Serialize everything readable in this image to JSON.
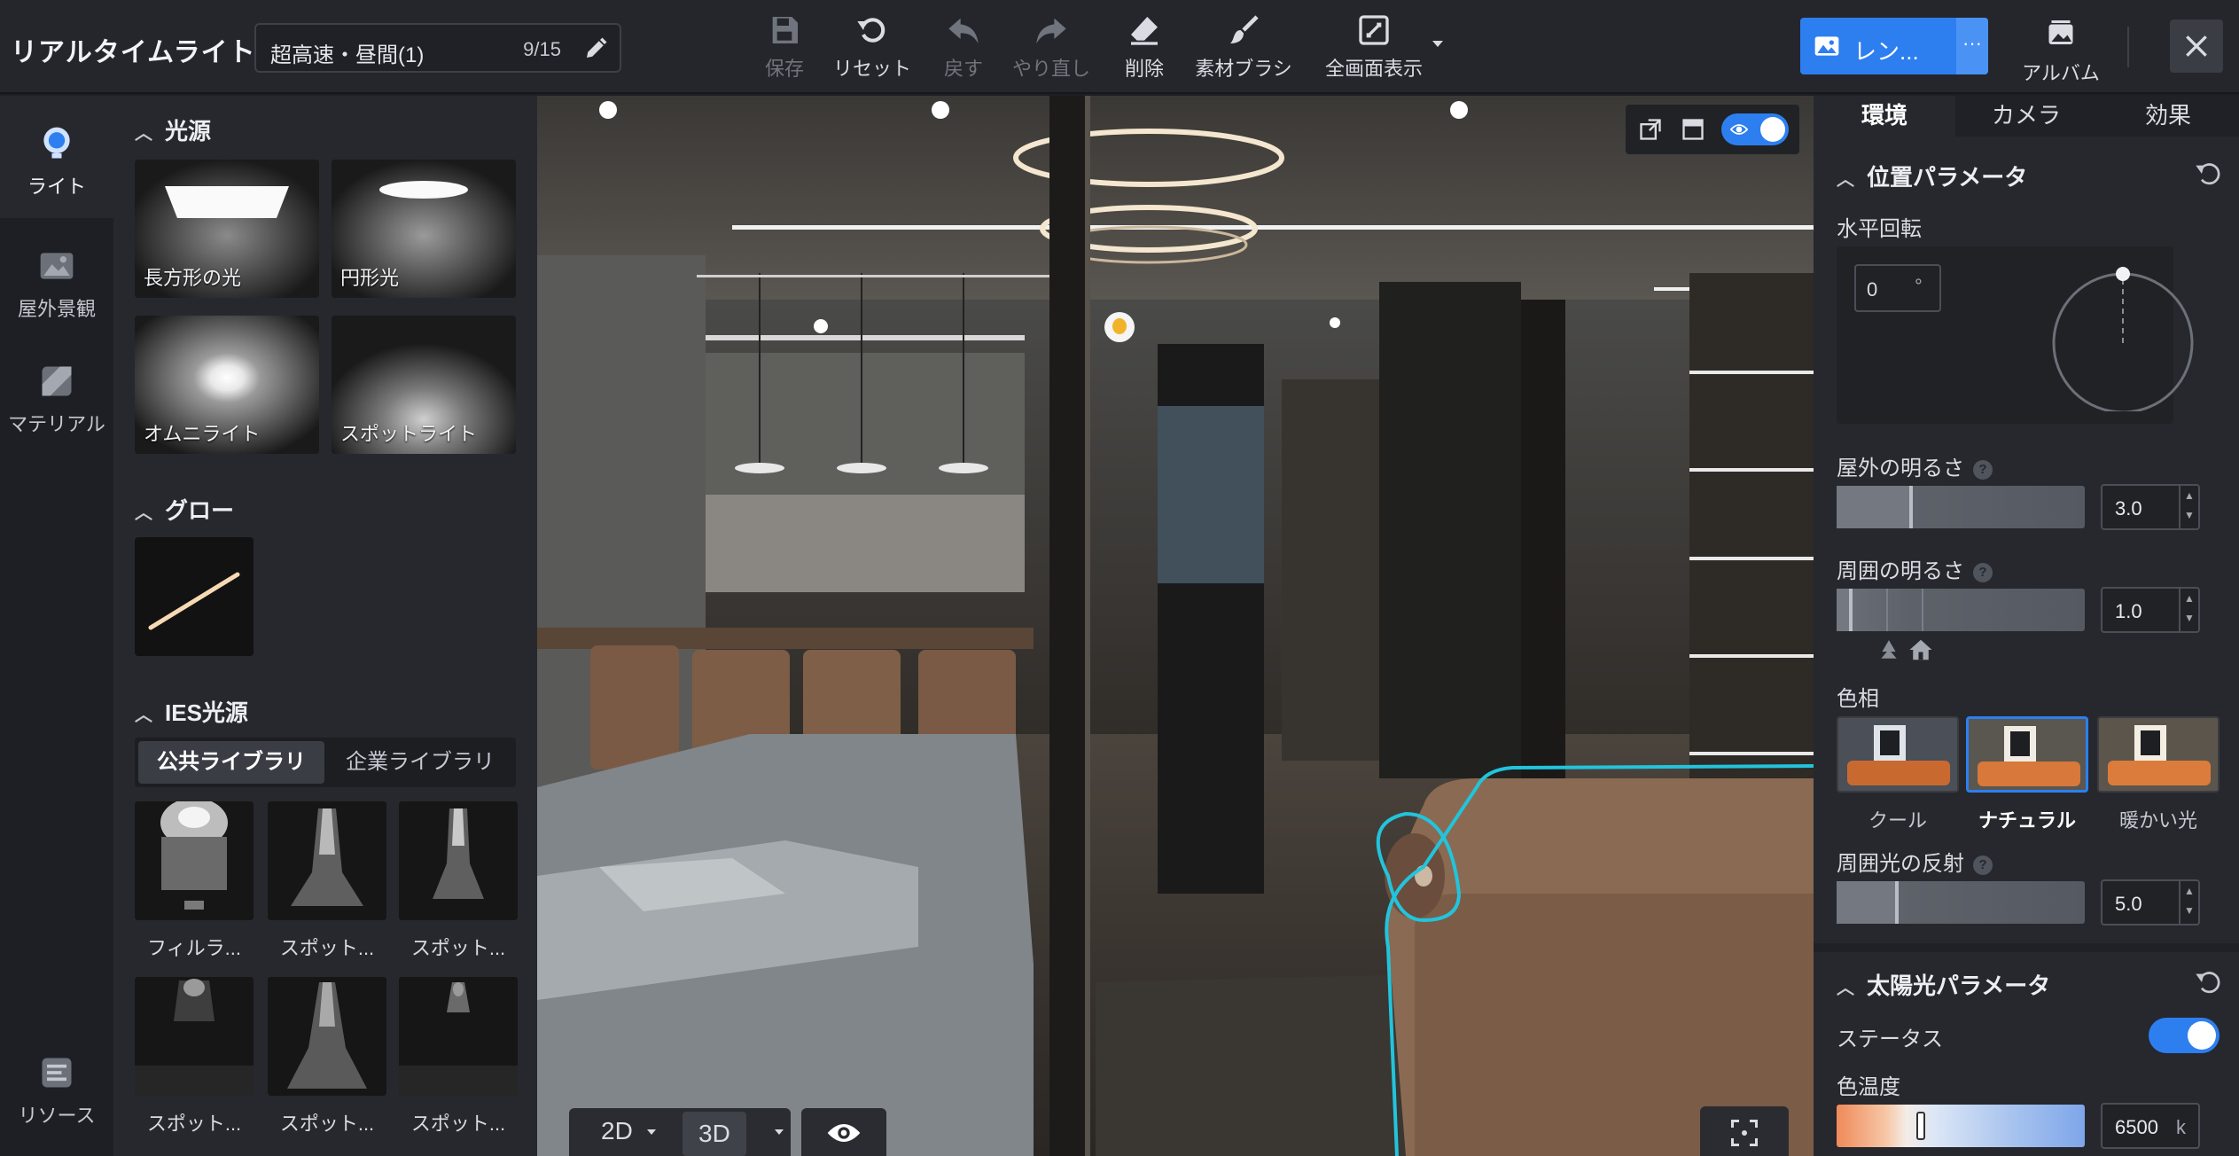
{
  "app": {
    "title": "リアルタイムライト"
  },
  "scene": {
    "name": "超高速・昼間(1)",
    "count": "9/15"
  },
  "toolbar": {
    "save": "保存",
    "reset": "リセット",
    "undo": "戻す",
    "redo": "やり直し",
    "delete": "削除",
    "brush": "素材ブラシ",
    "fullscreen": "全画面表示",
    "render": "レン...",
    "render_more": "···",
    "album": "アルバム"
  },
  "rail": {
    "light": "ライト",
    "outdoor": "屋外景観",
    "material": "マテリアル",
    "resource": "リソース"
  },
  "library": {
    "section_light": "光源",
    "lights": [
      "長方形の光",
      "円形光",
      "オムニライト",
      "スポットライト"
    ],
    "section_glow": "グロー",
    "section_ies": "IES光源",
    "tab_public": "公共ライブラリ",
    "tab_company": "企業ライブラリ",
    "ies_items": [
      "フィルラ...",
      "スポット...",
      "スポット...",
      "スポット...",
      "スポット...",
      "スポット..."
    ]
  },
  "viewport": {
    "mode_2d": "2D",
    "mode_3d": "3D"
  },
  "props": {
    "tabs": [
      "環境",
      "カメラ",
      "効果"
    ],
    "position_section": "位置パラメータ",
    "horizontal_rotation": "水平回転",
    "rotation_value": "0",
    "rotation_unit": "°",
    "outdoor_brightness": "屋外の明るさ",
    "outdoor_brightness_value": "3.0",
    "ambient_brightness": "周囲の明るさ",
    "ambient_brightness_value": "1.0",
    "tone": "色相",
    "tones": [
      "クール",
      "ナチュラル",
      "暖かい光"
    ],
    "selected_tone": "ナチュラル",
    "ambient_reflection": "周囲光の反射",
    "ambient_reflection_value": "5.0",
    "sun_section": "太陽光パラメータ",
    "status": "ステータス",
    "status_on": true,
    "color_temp": "色温度",
    "color_temp_value": "6500",
    "color_temp_unit": "k"
  },
  "colors": {
    "accent": "#2d7ff0",
    "selection_outline": "#22c4dc"
  }
}
